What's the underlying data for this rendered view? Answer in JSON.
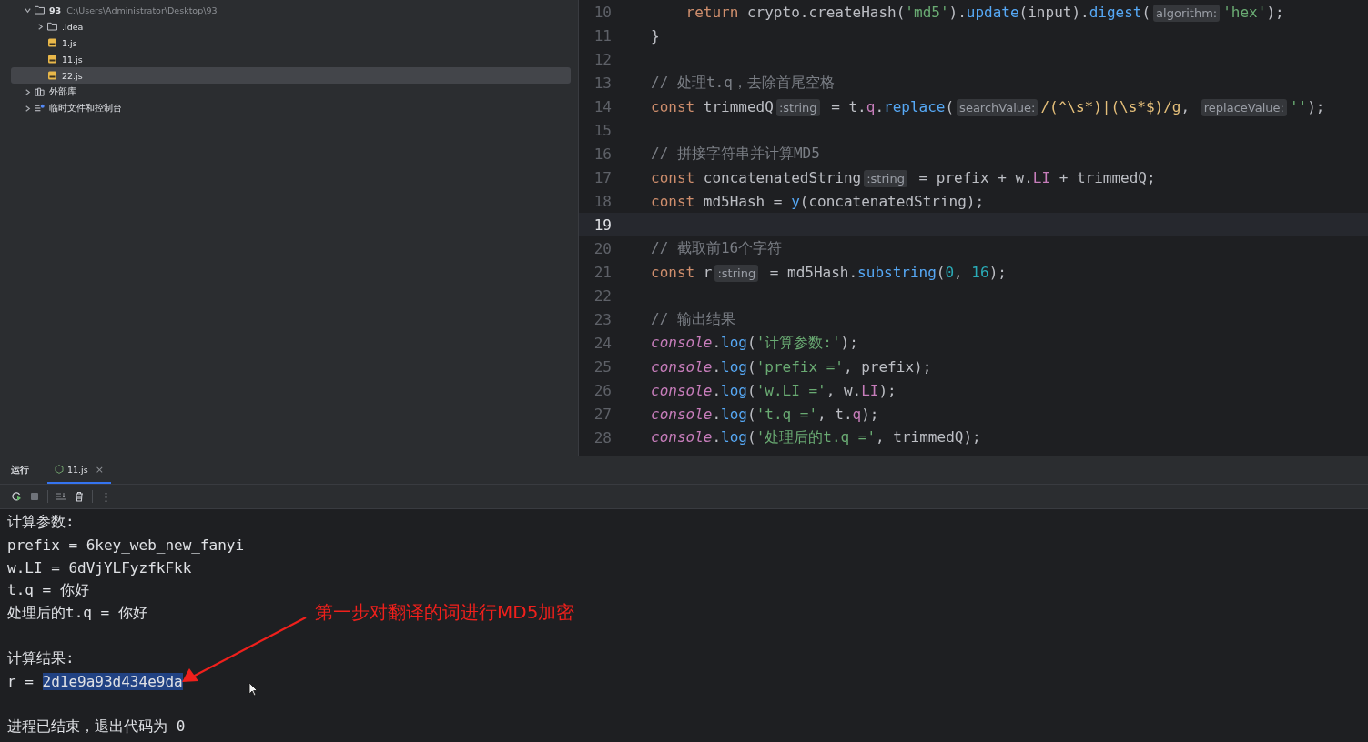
{
  "project_tree": {
    "items": [
      {
        "label": "93",
        "path": "C:\\Users\\Administrator\\Desktop\\93",
        "kind": "folder",
        "expanded": true,
        "selected": false,
        "children": [
          {
            "label": ".idea",
            "kind": "folder",
            "expanded": false,
            "selected": false
          },
          {
            "label": "1.js",
            "kind": "js",
            "selected": false
          },
          {
            "label": "11.js",
            "kind": "js",
            "selected": false
          },
          {
            "label": "22.js",
            "kind": "js",
            "selected": true
          }
        ]
      },
      {
        "label": "外部库",
        "kind": "library",
        "expanded": false,
        "selected": false
      },
      {
        "label": "临时文件和控制台",
        "kind": "scratch",
        "expanded": false,
        "selected": false
      }
    ]
  },
  "editor": {
    "lines": [
      {
        "number": "10",
        "current": false,
        "tokens": [
          {
            "kind": "kw",
            "t": "    return"
          },
          {
            "kind": "plain",
            "t": " crypto.createHash("
          },
          {
            "kind": "str",
            "t": "'md5'"
          },
          {
            "kind": "plain",
            "t": ")."
          },
          {
            "kind": "fn",
            "t": "update"
          },
          {
            "kind": "plain",
            "t": "(input)."
          },
          {
            "kind": "fn",
            "t": "digest"
          },
          {
            "kind": "plain",
            "t": "("
          },
          {
            "kind": "hint",
            "t": "algorithm:"
          },
          {
            "kind": "str",
            "t": "'hex'"
          },
          {
            "kind": "plain",
            "t": ");"
          }
        ]
      },
      {
        "number": "11",
        "current": false,
        "tokens": [
          {
            "kind": "plain",
            "t": "}"
          }
        ]
      },
      {
        "number": "12",
        "current": false
      },
      {
        "number": "13",
        "current": false,
        "tokens": [
          {
            "kind": "cmt",
            "t": "// 处理t.q，去除首尾空格"
          }
        ]
      },
      {
        "number": "14",
        "current": false,
        "tokens": [
          {
            "kind": "kw",
            "t": "const"
          },
          {
            "kind": "plain",
            "t": " trimmedQ"
          },
          {
            "kind": "hint",
            "t": ":string"
          },
          {
            "kind": "plain",
            "t": " = t."
          },
          {
            "kind": "prop",
            "t": "q"
          },
          {
            "kind": "plain",
            "t": "."
          },
          {
            "kind": "fn",
            "t": "replace"
          },
          {
            "kind": "plain",
            "t": "("
          },
          {
            "kind": "hint",
            "t": "searchValue:"
          },
          {
            "kind": "rx",
            "t": "/(^\\s*)|(\\s*$)/g"
          },
          {
            "kind": "plain",
            "t": ", "
          },
          {
            "kind": "hint",
            "t": "replaceValue:"
          },
          {
            "kind": "str",
            "t": "''"
          },
          {
            "kind": "plain",
            "t": ");"
          }
        ]
      },
      {
        "number": "15",
        "current": false
      },
      {
        "number": "16",
        "current": false,
        "tokens": [
          {
            "kind": "cmt",
            "t": "// 拼接字符串并计算MD5"
          }
        ]
      },
      {
        "number": "17",
        "current": false,
        "tokens": [
          {
            "kind": "kw",
            "t": "const"
          },
          {
            "kind": "plain",
            "t": " concatenatedString"
          },
          {
            "kind": "hint",
            "t": ":string"
          },
          {
            "kind": "plain",
            "t": " = prefix + w."
          },
          {
            "kind": "prop",
            "t": "LI"
          },
          {
            "kind": "plain",
            "t": " + trimmedQ;"
          }
        ]
      },
      {
        "number": "18",
        "current": false,
        "tokens": [
          {
            "kind": "kw",
            "t": "const"
          },
          {
            "kind": "plain",
            "t": " md5Hash = "
          },
          {
            "kind": "fn",
            "t": "y"
          },
          {
            "kind": "plain",
            "t": "(concatenatedString);"
          }
        ]
      },
      {
        "number": "19",
        "current": true
      },
      {
        "number": "20",
        "current": false,
        "tokens": [
          {
            "kind": "cmt",
            "t": "// 截取前16个字符"
          }
        ]
      },
      {
        "number": "21",
        "current": false,
        "tokens": [
          {
            "kind": "kw",
            "t": "const"
          },
          {
            "kind": "plain",
            "t": " r"
          },
          {
            "kind": "hint",
            "t": ":string"
          },
          {
            "kind": "plain",
            "t": " = md5Hash."
          },
          {
            "kind": "fn",
            "t": "substring"
          },
          {
            "kind": "plain",
            "t": "("
          },
          {
            "kind": "num",
            "t": "0"
          },
          {
            "kind": "plain",
            "t": ", "
          },
          {
            "kind": "num",
            "t": "16"
          },
          {
            "kind": "plain",
            "t": ");"
          }
        ]
      },
      {
        "number": "22",
        "current": false
      },
      {
        "number": "23",
        "current": false,
        "tokens": [
          {
            "kind": "cmt",
            "t": "// 输出结果"
          }
        ]
      },
      {
        "number": "24",
        "current": false,
        "tokens": [
          {
            "kind": "con",
            "t": "console"
          },
          {
            "kind": "plain",
            "t": "."
          },
          {
            "kind": "fn",
            "t": "log"
          },
          {
            "kind": "plain",
            "t": "("
          },
          {
            "kind": "str",
            "t": "'计算参数:'"
          },
          {
            "kind": "plain",
            "t": ");"
          }
        ]
      },
      {
        "number": "25",
        "current": false,
        "tokens": [
          {
            "kind": "con",
            "t": "console"
          },
          {
            "kind": "plain",
            "t": "."
          },
          {
            "kind": "fn",
            "t": "log"
          },
          {
            "kind": "plain",
            "t": "("
          },
          {
            "kind": "str",
            "t": "'prefix ='"
          },
          {
            "kind": "plain",
            "t": ", prefix);"
          }
        ]
      },
      {
        "number": "26",
        "current": false,
        "tokens": [
          {
            "kind": "con",
            "t": "console"
          },
          {
            "kind": "plain",
            "t": "."
          },
          {
            "kind": "fn",
            "t": "log"
          },
          {
            "kind": "plain",
            "t": "("
          },
          {
            "kind": "str",
            "t": "'w.LI ='"
          },
          {
            "kind": "plain",
            "t": ", w."
          },
          {
            "kind": "prop",
            "t": "LI"
          },
          {
            "kind": "plain",
            "t": ");"
          }
        ]
      },
      {
        "number": "27",
        "current": false,
        "tokens": [
          {
            "kind": "con",
            "t": "console"
          },
          {
            "kind": "plain",
            "t": "."
          },
          {
            "kind": "fn",
            "t": "log"
          },
          {
            "kind": "plain",
            "t": "("
          },
          {
            "kind": "str",
            "t": "'t.q ='"
          },
          {
            "kind": "plain",
            "t": ", t."
          },
          {
            "kind": "prop",
            "t": "q"
          },
          {
            "kind": "plain",
            "t": ");"
          }
        ]
      },
      {
        "number": "28",
        "current": false,
        "tokens": [
          {
            "kind": "con",
            "t": "console"
          },
          {
            "kind": "plain",
            "t": "."
          },
          {
            "kind": "fn",
            "t": "log"
          },
          {
            "kind": "plain",
            "t": "("
          },
          {
            "kind": "str",
            "t": "'处理后的t.q ='"
          },
          {
            "kind": "plain",
            "t": ", trimmedQ);"
          }
        ]
      }
    ]
  },
  "run_panel": {
    "title": "运行",
    "tabs": [
      {
        "label": "11.js",
        "selected": true,
        "closable": true
      }
    ],
    "close_glyph": "×",
    "menu_glyph": "⋮",
    "console": [
      {
        "parts": [
          {
            "text": "计算参数:",
            "selected": false
          }
        ]
      },
      {
        "parts": [
          {
            "text": "prefix = 6key_web_new_fanyi",
            "selected": false
          }
        ]
      },
      {
        "parts": [
          {
            "text": "w.LI = 6dVjYLFyzfkFkk",
            "selected": false
          }
        ]
      },
      {
        "parts": [
          {
            "text": "t.q = 你好",
            "selected": false
          }
        ]
      },
      {
        "parts": [
          {
            "text": "处理后的t.q = 你好",
            "selected": false
          }
        ]
      },
      {
        "gap_before": true,
        "parts": [
          {
            "text": "计算结果:",
            "selected": false
          }
        ]
      },
      {
        "parts": [
          {
            "text": "r = ",
            "selected": false
          },
          {
            "text": "2d1e9a93d434e9da",
            "selected": true
          }
        ]
      },
      {
        "gap_before": true,
        "parts": [
          {
            "text": "进程已结束，退出代码为 0",
            "selected": false
          }
        ]
      }
    ],
    "annotation": "第一步对翻译的词进行MD5加密"
  }
}
